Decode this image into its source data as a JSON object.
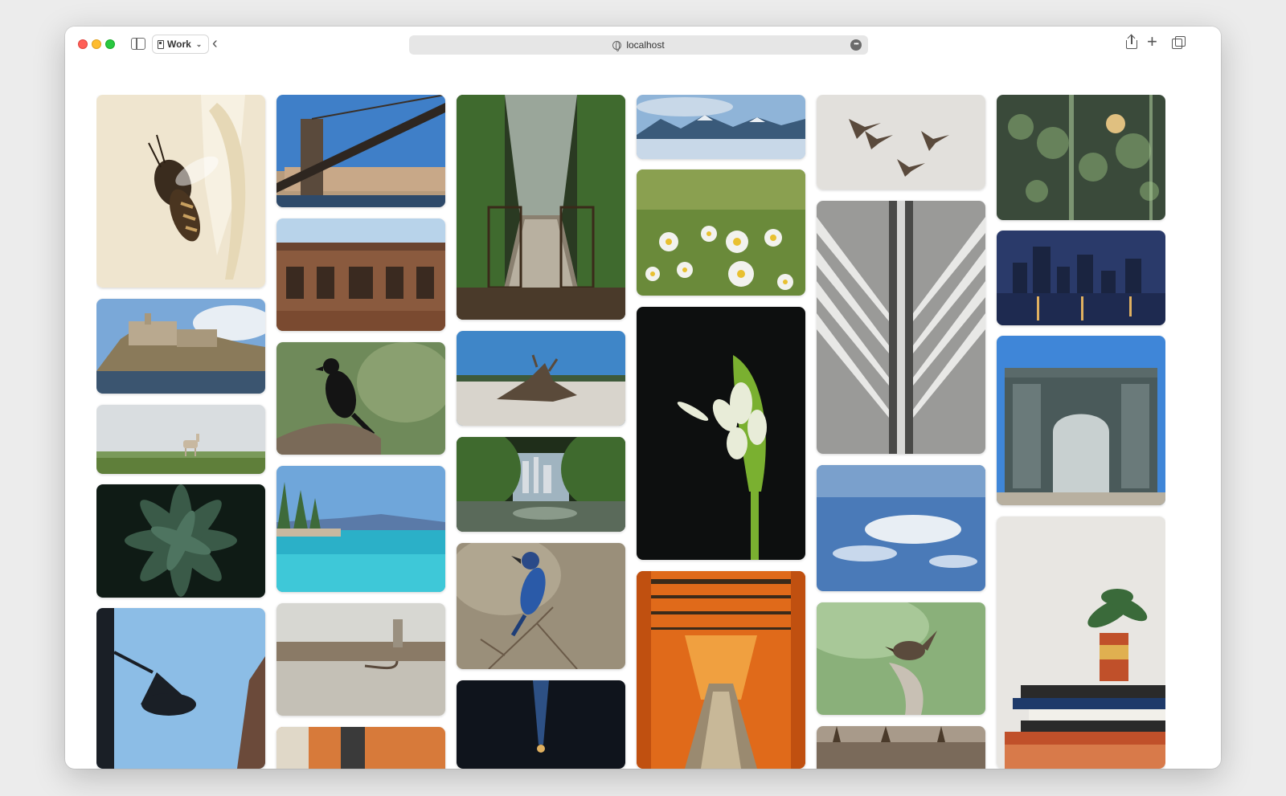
{
  "browser": {
    "profile_label": "Work",
    "address": "localhost",
    "colors": {
      "close": "#ff5f57",
      "minimize": "#febc2e",
      "zoom": "#28c840",
      "address_bg": "#e6e6e6"
    }
  },
  "gallery": {
    "columns": [
      {
        "photos": [
          {
            "name": "bee",
            "colors": [
              "#efe5cf",
              "#e6d8b6",
              "#3a2c1e"
            ]
          },
          {
            "name": "castle-on-lake",
            "colors": [
              "#7aa8d8",
              "#b9a98f",
              "#3b5570"
            ]
          },
          {
            "name": "deer-in-field",
            "colors": [
              "#d9dde0",
              "#cbd1d2",
              "#5f7f3a"
            ]
          },
          {
            "name": "green-succulent",
            "colors": [
              "#1f3229",
              "#3a5a48",
              "#0f1b15"
            ]
          },
          {
            "name": "street-lamp",
            "colors": [
              "#8cbde6",
              "#1a1f26",
              "#6b4a3a"
            ]
          }
        ]
      },
      {
        "photos": [
          {
            "name": "brooklyn-bridge",
            "colors": [
              "#3f7fc8",
              "#5a4a3c",
              "#b79b7c"
            ]
          },
          {
            "name": "brick-building",
            "colors": [
              "#b8d3ea",
              "#8a5a3e",
              "#3a2a20"
            ]
          },
          {
            "name": "crow-on-branch",
            "colors": [
              "#6f8a5a",
              "#141414",
              "#7a6a58"
            ]
          },
          {
            "name": "lake-tahoe",
            "colors": [
              "#6fa6da",
              "#2bb0c8",
              "#3e6a3a"
            ]
          },
          {
            "name": "pier-post",
            "colors": [
              "#d7d7d2",
              "#8a7a66",
              "#c4c0b6"
            ]
          },
          {
            "name": "orange-wall",
            "colors": [
              "#d77a3a",
              "#3a3a3a",
              "#e0d8c8"
            ]
          }
        ]
      },
      {
        "photos": [
          {
            "name": "bamboo-bridge",
            "colors": [
              "#3f6a2e",
              "#9aa69a",
              "#2a3a22"
            ]
          },
          {
            "name": "driftwood-beach",
            "colors": [
              "#3f86c8",
              "#d8d4cc",
              "#5a4a3a"
            ]
          },
          {
            "name": "city-through-trees",
            "colors": [
              "#3f6a2e",
              "#a0b4c0",
              "#1f2e1a"
            ]
          },
          {
            "name": "blue-jay",
            "colors": [
              "#9a8f7a",
              "#2a5aa8",
              "#6a5a48"
            ]
          },
          {
            "name": "dark-light",
            "colors": [
              "#0f141c",
              "#3a6ab0",
              "#e0b060"
            ]
          }
        ]
      },
      {
        "photos": [
          {
            "name": "mountain-lake",
            "colors": [
              "#8fb4d8",
              "#3a5a7a",
              "#c8d8e8"
            ]
          },
          {
            "name": "daisies",
            "colors": [
              "#6a8a3a",
              "#f2f2ee",
              "#e8c030"
            ]
          },
          {
            "name": "white-flower-bud",
            "colors": [
              "#0d0f0f",
              "#e8ecd8",
              "#7ab030"
            ]
          },
          {
            "name": "torii-gates",
            "colors": [
              "#e06a1a",
              "#3a2a1a",
              "#f0a040"
            ]
          }
        ]
      },
      {
        "photos": [
          {
            "name": "pelicans",
            "colors": [
              "#e2e0dc",
              "#5a4a3c",
              "#d8d4ce"
            ]
          },
          {
            "name": "architecture-ribs",
            "colors": [
              "#9a9a98",
              "#e8e8e6",
              "#4a4a48"
            ]
          },
          {
            "name": "aerial-clouds",
            "colors": [
              "#4a7ab8",
              "#e8eef4",
              "#7aa0cc"
            ]
          },
          {
            "name": "wren-on-branch",
            "colors": [
              "#8ab07a",
              "#5a4a3c",
              "#c8c0b4"
            ]
          },
          {
            "name": "forest-edge",
            "colors": [
              "#7a6a5a",
              "#a89a8a",
              "#4a3a2a"
            ]
          }
        ]
      },
      {
        "photos": [
          {
            "name": "bokeh-lights",
            "colors": [
              "#3a4a3a",
              "#7a9a6a",
              "#e0c080"
            ]
          },
          {
            "name": "city-skyline-night",
            "colors": [
              "#2a3a6a",
              "#e0b060",
              "#1a2440"
            ]
          },
          {
            "name": "ornate-gate",
            "colors": [
              "#3f86d8",
              "#4a5a5a",
              "#c8d0d0"
            ]
          },
          {
            "name": "plant-on-books",
            "colors": [
              "#e8e6e2",
              "#3a6a3a",
              "#c0502a"
            ]
          }
        ]
      }
    ]
  }
}
